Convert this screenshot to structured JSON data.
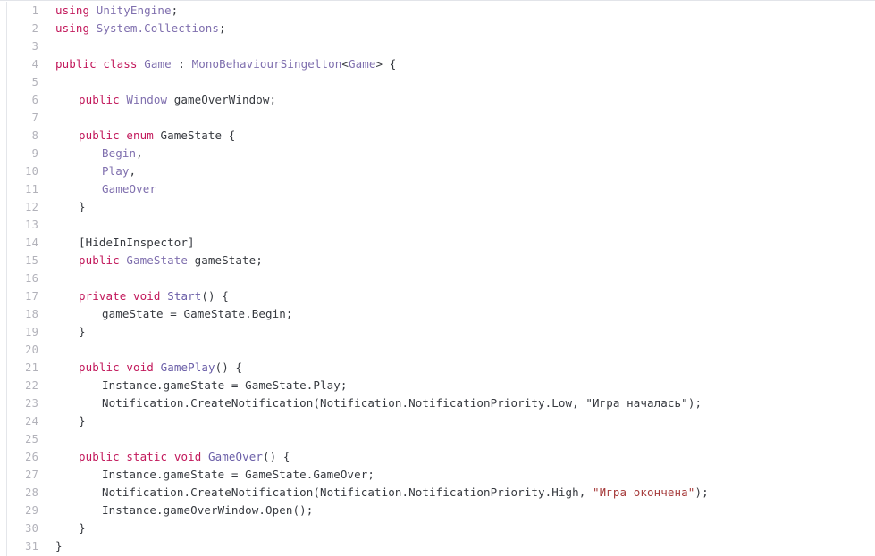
{
  "editor": {
    "language": "C#",
    "theme": "light",
    "background_color": "#ffffff",
    "gutter_text_color": "#b2b2ba",
    "default_text_color": "#36393f",
    "keyword_color": "#c2185b",
    "type_color": "#7f6fae",
    "string_color": "#a63b3b",
    "border_color": "#e2e4e9",
    "total_lines": 31,
    "indent_size": 4
  },
  "code": {
    "lines": [
      {
        "number": "1",
        "indent": 0,
        "tokens": [
          {
            "t": "using",
            "c": "kw"
          },
          {
            "t": " ",
            "c": "plain"
          },
          {
            "t": "UnityEngine",
            "c": "type"
          },
          {
            "t": ";",
            "c": "plain"
          }
        ]
      },
      {
        "number": "2",
        "indent": 0,
        "tokens": [
          {
            "t": "using",
            "c": "kw"
          },
          {
            "t": " ",
            "c": "plain"
          },
          {
            "t": "System.Collections",
            "c": "type"
          },
          {
            "t": ";",
            "c": "plain"
          }
        ]
      },
      {
        "number": "3",
        "indent": 0,
        "tokens": []
      },
      {
        "number": "4",
        "indent": 0,
        "tokens": [
          {
            "t": "public",
            "c": "kw"
          },
          {
            "t": " ",
            "c": "plain"
          },
          {
            "t": "class",
            "c": "kw"
          },
          {
            "t": " ",
            "c": "plain"
          },
          {
            "t": "Game",
            "c": "type"
          },
          {
            "t": " : ",
            "c": "plain"
          },
          {
            "t": "MonoBehaviourSingelton",
            "c": "type"
          },
          {
            "t": "<",
            "c": "plain"
          },
          {
            "t": "Game",
            "c": "type"
          },
          {
            "t": "> {",
            "c": "plain"
          }
        ]
      },
      {
        "number": "5",
        "indent": 0,
        "tokens": []
      },
      {
        "number": "6",
        "indent": 1,
        "tokens": [
          {
            "t": "public",
            "c": "kw"
          },
          {
            "t": " ",
            "c": "plain"
          },
          {
            "t": "Window",
            "c": "type"
          },
          {
            "t": " gameOverWindow;",
            "c": "plain"
          }
        ]
      },
      {
        "number": "7",
        "indent": 0,
        "tokens": []
      },
      {
        "number": "8",
        "indent": 1,
        "tokens": [
          {
            "t": "public",
            "c": "kw"
          },
          {
            "t": " ",
            "c": "plain"
          },
          {
            "t": "enum",
            "c": "kw"
          },
          {
            "t": " GameState {",
            "c": "plain"
          }
        ]
      },
      {
        "number": "9",
        "indent": 2,
        "tokens": [
          {
            "t": "Begin",
            "c": "member"
          },
          {
            "t": ",",
            "c": "plain"
          }
        ]
      },
      {
        "number": "10",
        "indent": 2,
        "tokens": [
          {
            "t": "Play",
            "c": "member"
          },
          {
            "t": ",",
            "c": "plain"
          }
        ]
      },
      {
        "number": "11",
        "indent": 2,
        "tokens": [
          {
            "t": "GameOver",
            "c": "member"
          }
        ]
      },
      {
        "number": "12",
        "indent": 1,
        "tokens": [
          {
            "t": "}",
            "c": "plain"
          }
        ]
      },
      {
        "number": "13",
        "indent": 0,
        "tokens": []
      },
      {
        "number": "14",
        "indent": 1,
        "tokens": [
          {
            "t": "[HideInInspector]",
            "c": "attr"
          }
        ]
      },
      {
        "number": "15",
        "indent": 1,
        "tokens": [
          {
            "t": "public",
            "c": "kw"
          },
          {
            "t": " ",
            "c": "plain"
          },
          {
            "t": "GameState",
            "c": "type"
          },
          {
            "t": " gameState;",
            "c": "plain"
          }
        ]
      },
      {
        "number": "16",
        "indent": 0,
        "tokens": []
      },
      {
        "number": "17",
        "indent": 1,
        "tokens": [
          {
            "t": "private",
            "c": "kw"
          },
          {
            "t": " ",
            "c": "plain"
          },
          {
            "t": "void",
            "c": "kw"
          },
          {
            "t": " ",
            "c": "plain"
          },
          {
            "t": "Start",
            "c": "fn"
          },
          {
            "t": "() {",
            "c": "plain"
          }
        ]
      },
      {
        "number": "18",
        "indent": 2,
        "tokens": [
          {
            "t": "gameState = GameState.Begin;",
            "c": "plain"
          }
        ]
      },
      {
        "number": "19",
        "indent": 1,
        "tokens": [
          {
            "t": "}",
            "c": "plain"
          }
        ]
      },
      {
        "number": "20",
        "indent": 0,
        "tokens": []
      },
      {
        "number": "21",
        "indent": 1,
        "tokens": [
          {
            "t": "public",
            "c": "kw"
          },
          {
            "t": " ",
            "c": "plain"
          },
          {
            "t": "void",
            "c": "kw"
          },
          {
            "t": " ",
            "c": "plain"
          },
          {
            "t": "GamePlay",
            "c": "fn"
          },
          {
            "t": "() {",
            "c": "plain"
          }
        ]
      },
      {
        "number": "22",
        "indent": 2,
        "tokens": [
          {
            "t": "Instance.gameState = GameState.Play;",
            "c": "plain"
          }
        ]
      },
      {
        "number": "23",
        "indent": 2,
        "tokens": [
          {
            "t": "Notification.CreateNotification(Notification.NotificationPriority.Low, ",
            "c": "plain"
          },
          {
            "t": "\"Игра началась\"",
            "c": "plain"
          },
          {
            "t": ");",
            "c": "plain"
          }
        ]
      },
      {
        "number": "24",
        "indent": 1,
        "tokens": [
          {
            "t": "}",
            "c": "plain"
          }
        ]
      },
      {
        "number": "25",
        "indent": 0,
        "tokens": []
      },
      {
        "number": "26",
        "indent": 1,
        "tokens": [
          {
            "t": "public",
            "c": "kw"
          },
          {
            "t": " ",
            "c": "plain"
          },
          {
            "t": "static",
            "c": "kw"
          },
          {
            "t": " ",
            "c": "plain"
          },
          {
            "t": "void",
            "c": "kw"
          },
          {
            "t": " ",
            "c": "plain"
          },
          {
            "t": "GameOver",
            "c": "fn"
          },
          {
            "t": "() {",
            "c": "plain"
          }
        ]
      },
      {
        "number": "27",
        "indent": 2,
        "tokens": [
          {
            "t": "Instance.gameState = GameState.GameOver;",
            "c": "plain"
          }
        ]
      },
      {
        "number": "28",
        "indent": 2,
        "tokens": [
          {
            "t": "Notification.CreateNotification(Notification.NotificationPriority.High, ",
            "c": "plain"
          },
          {
            "t": "\"Игра окончена\"",
            "c": "str"
          },
          {
            "t": ");",
            "c": "plain"
          }
        ]
      },
      {
        "number": "29",
        "indent": 2,
        "tokens": [
          {
            "t": "Instance.gameOverWindow.Open();",
            "c": "plain"
          }
        ]
      },
      {
        "number": "30",
        "indent": 1,
        "tokens": [
          {
            "t": "}",
            "c": "plain"
          }
        ]
      },
      {
        "number": "31",
        "indent": 0,
        "tokens": [
          {
            "t": "}",
            "c": "plain"
          }
        ]
      }
    ]
  }
}
